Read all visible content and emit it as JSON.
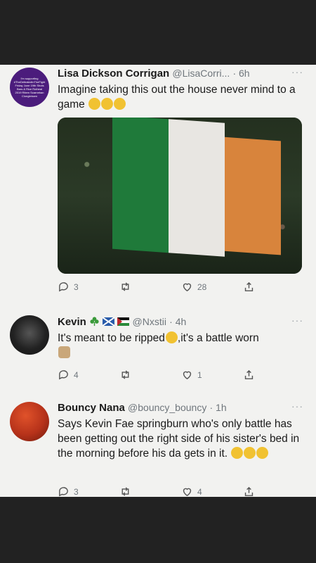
{
  "tweets": [
    {
      "name": "Lisa Dickson Corrigan",
      "handle": "@LisaCorri...",
      "time": "· 6h",
      "text": "Imagine taking this out the house never mind to a game",
      "replies": "3",
      "likes": "28",
      "avatar_text": "I'm supporting #TheDefeatedInTheFight Friday June 19th Shots Bars & Rice Rotheal 2019 Ritem Scarneban Clongletown"
    },
    {
      "name": "Kevin",
      "handle": "@Nxstii",
      "time": "· 4h",
      "text_a": "It's meant to be ripped",
      "text_b": ",it's a battle worn",
      "replies": "4",
      "likes": "1"
    },
    {
      "name": "Bouncy Nana",
      "handle": "@bouncy_bouncy",
      "time": "· 1h",
      "text": "Says Kevin Fae springburn who's only battle has been getting out the right side of his sister's bed in the morning before his da gets in it.",
      "replies": "3",
      "likes": "4"
    }
  ],
  "more_label": "···",
  "colors": {
    "sheet": "#f2f2f0",
    "muted": "#6f767c",
    "emoji": "#f1c232"
  },
  "icons": [
    "reply-icon",
    "retweet-icon",
    "like-icon",
    "share-icon",
    "shamrock-icon",
    "scotland-flag-icon",
    "palestine-flag-icon"
  ]
}
